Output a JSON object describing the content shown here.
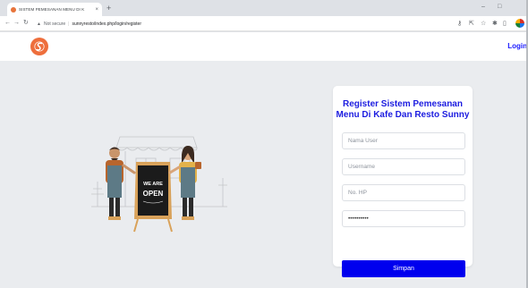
{
  "browser": {
    "tab_title": "SISTEM PEMESANAN MENU DI K",
    "tab_close": "×",
    "new_tab": "+",
    "url_warning": "Not secure",
    "url": "sunnyresto/index.php/login/register",
    "minimize": "–",
    "maximize": "□"
  },
  "header": {
    "login_label": "Login"
  },
  "illustration": {
    "board_line1": "WE ARE",
    "board_line2": "OPEN"
  },
  "form": {
    "title_line1": "Register Sistem Pemesanan",
    "title_line2": "Menu Di Kafe Dan Resto Sunny",
    "name_placeholder": "Nama User",
    "username_placeholder": "Username",
    "phone_placeholder": "No. HP",
    "password_value": "••••••••••",
    "submit_label": "Simpan"
  },
  "colors": {
    "accent": "#0000ee",
    "title": "#1c1ce0",
    "logo": "#ee6e3c",
    "background": "#eaecef"
  }
}
